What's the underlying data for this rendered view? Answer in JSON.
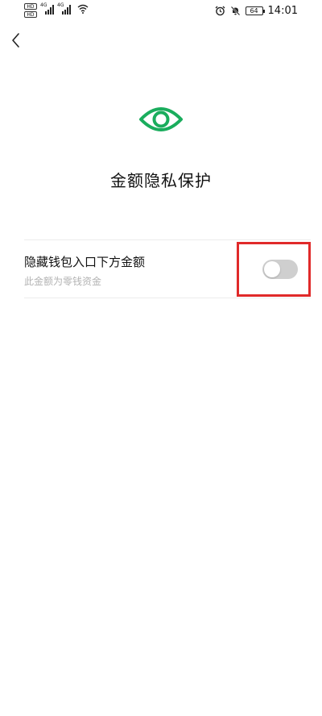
{
  "status_bar": {
    "hd1": "HD",
    "hd2": "HD",
    "net1": "4G",
    "net2": "4G",
    "battery": "64",
    "time": "14:01"
  },
  "page": {
    "title": "金额隐私保护"
  },
  "setting": {
    "title": "隐藏钱包入口下方金额",
    "subtitle": "此金额为零钱资金",
    "enabled": false
  },
  "colors": {
    "brand_green": "#1aad5d",
    "highlight_red": "#e02a2a",
    "toggle_off": "#cfcfcf"
  },
  "icons": {
    "back": "chevron-left-icon",
    "eye": "eye-icon",
    "wifi": "wifi-icon",
    "alarm": "alarm-icon",
    "mute": "bell-muted-icon"
  }
}
